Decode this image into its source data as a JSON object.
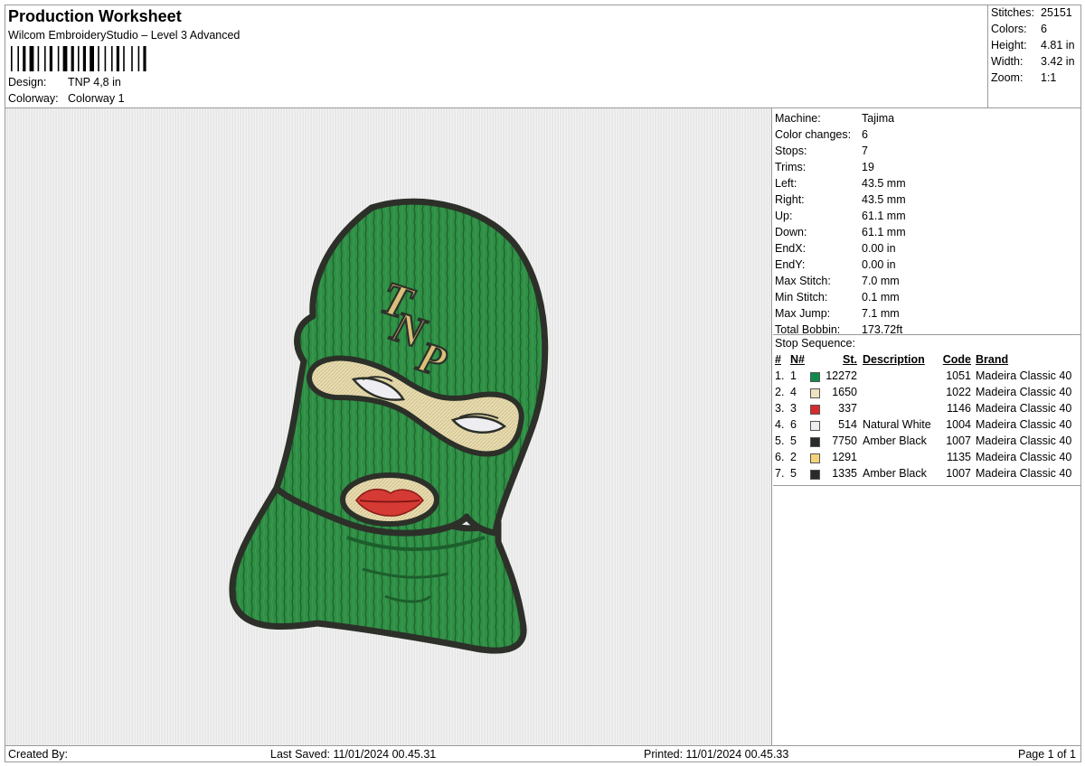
{
  "header": {
    "title": "Production Worksheet",
    "subtitle": "Wilcom EmbroideryStudio – Level 3 Advanced",
    "design_label": "Design:",
    "design_value": "TNP 4,8 in",
    "colorway_label": "Colorway:",
    "colorway_value": "Colorway 1"
  },
  "summary": {
    "stitches_label": "Stitches:",
    "stitches": "25151",
    "colors_label": "Colors:",
    "colors": "6",
    "height_label": "Height:",
    "height": "4.81 in",
    "width_label": "Width:",
    "width": "3.42 in",
    "zoom_label": "Zoom:",
    "zoom": "1:1"
  },
  "design_text": "TNP",
  "properties": [
    {
      "label": "Machine:",
      "value": "Tajima"
    },
    {
      "label": "Color changes:",
      "value": "6"
    },
    {
      "label": "Stops:",
      "value": "7"
    },
    {
      "label": "Trims:",
      "value": "19"
    },
    {
      "label": "Left:",
      "value": "43.5 mm"
    },
    {
      "label": "Right:",
      "value": "43.5 mm"
    },
    {
      "label": "Up:",
      "value": "61.1 mm"
    },
    {
      "label": "Down:",
      "value": "61.1 mm"
    },
    {
      "label": "EndX:",
      "value": "0.00 in"
    },
    {
      "label": "EndY:",
      "value": "0.00 in"
    },
    {
      "label": "Max Stitch:",
      "value": "7.0 mm"
    },
    {
      "label": "Min Stitch:",
      "value": "0.1 mm"
    },
    {
      "label": "Max Jump:",
      "value": "7.1 mm"
    },
    {
      "label": "Total Bobbin:",
      "value": "173.72ft"
    }
  ],
  "stop_sequence": {
    "title": "Stop Sequence:",
    "headers": {
      "idx": "#",
      "n": "N#",
      "st": "St.",
      "desc": "Description",
      "code": "Code",
      "brand": "Brand"
    },
    "rows": [
      {
        "idx": "1.",
        "n": "1",
        "color": "#0e8a4a",
        "st": "12272",
        "desc": "",
        "code": "1051",
        "brand": "Madeira Classic 40"
      },
      {
        "idx": "2.",
        "n": "4",
        "color": "#ece3bf",
        "st": "1650",
        "desc": "",
        "code": "1022",
        "brand": "Madeira Classic 40"
      },
      {
        "idx": "3.",
        "n": "3",
        "color": "#d82a2a",
        "st": "337",
        "desc": "",
        "code": "1146",
        "brand": "Madeira Classic 40"
      },
      {
        "idx": "4.",
        "n": "6",
        "color": "#eeeef2",
        "st": "514",
        "desc": "Natural White",
        "code": "1004",
        "brand": "Madeira Classic 40"
      },
      {
        "idx": "5.",
        "n": "5",
        "color": "#2a2a2a",
        "st": "7750",
        "desc": "Amber Black",
        "code": "1007",
        "brand": "Madeira Classic 40"
      },
      {
        "idx": "6.",
        "n": "2",
        "color": "#f3d37a",
        "st": "1291",
        "desc": "",
        "code": "1135",
        "brand": "Madeira Classic 40"
      },
      {
        "idx": "7.",
        "n": "5",
        "color": "#2a2a2a",
        "st": "1335",
        "desc": "Amber Black",
        "code": "1007",
        "brand": "Madeira Classic 40"
      }
    ]
  },
  "footer": {
    "created_by": "Created By:",
    "last_saved": "Last Saved: 11/01/2024 00.45.31",
    "printed": "Printed: 11/01/2024 00.45.33",
    "page": "Page 1 of 1"
  },
  "colors": {
    "mask_green": "#2f8f45",
    "outline": "#2c3029",
    "cream": "#e8dcb0",
    "gold": "#d9c07a",
    "lip_red": "#d63a34"
  }
}
